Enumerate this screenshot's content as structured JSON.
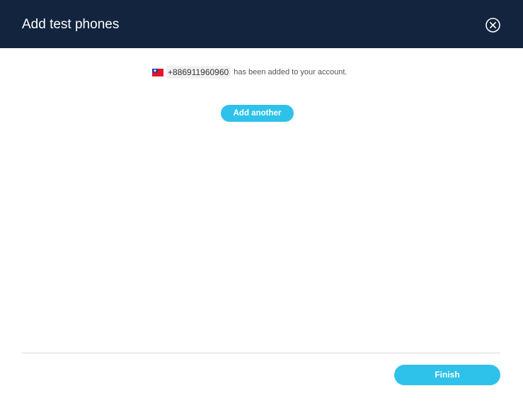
{
  "dialog": {
    "title": "Add test phones",
    "close_icon": "close-circle-icon"
  },
  "confirmation": {
    "flag_icon": "taiwan-flag-icon",
    "phone_number": "+886911960960",
    "message": "has been added to your account."
  },
  "actions": {
    "add_another_label": "Add another",
    "finish_label": "Finish"
  },
  "colors": {
    "header_bg": "#13243f",
    "accent": "#2ec2ea",
    "divider": "#d9d9d9"
  }
}
